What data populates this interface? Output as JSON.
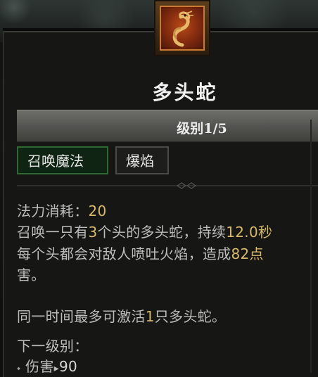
{
  "skill": {
    "title": "多头蛇",
    "level": "级别1/5",
    "tags": [
      "召唤魔法",
      "爆焰"
    ],
    "mana_label": "法力消耗：",
    "mana_value": "20",
    "desc": {
      "l1_a": "召唤一只有",
      "l1_num": "3",
      "l1_b": "个头的多头蛇，持续",
      "l1_dur": "12.0秒",
      "l2_a": "每个头都会对敌人喷吐火焰，造成",
      "l2_num": "82点",
      "l3": "害。",
      "l4_a": "同一时间最多可激活",
      "l4_num": "1",
      "l4_b": "只多头蛇。"
    },
    "next_level_label": "下一级别：",
    "next_damage_label": "伤害",
    "next_damage_value": "90"
  },
  "icons": {
    "skill_icon": "hydra-icon",
    "bullet": "diamond-bullet-icon",
    "arrow": "triangle-right-icon"
  },
  "colors": {
    "highlight": "#d8b96a",
    "text": "#bdbdbd",
    "tag_school_border": "#2d6a33"
  }
}
